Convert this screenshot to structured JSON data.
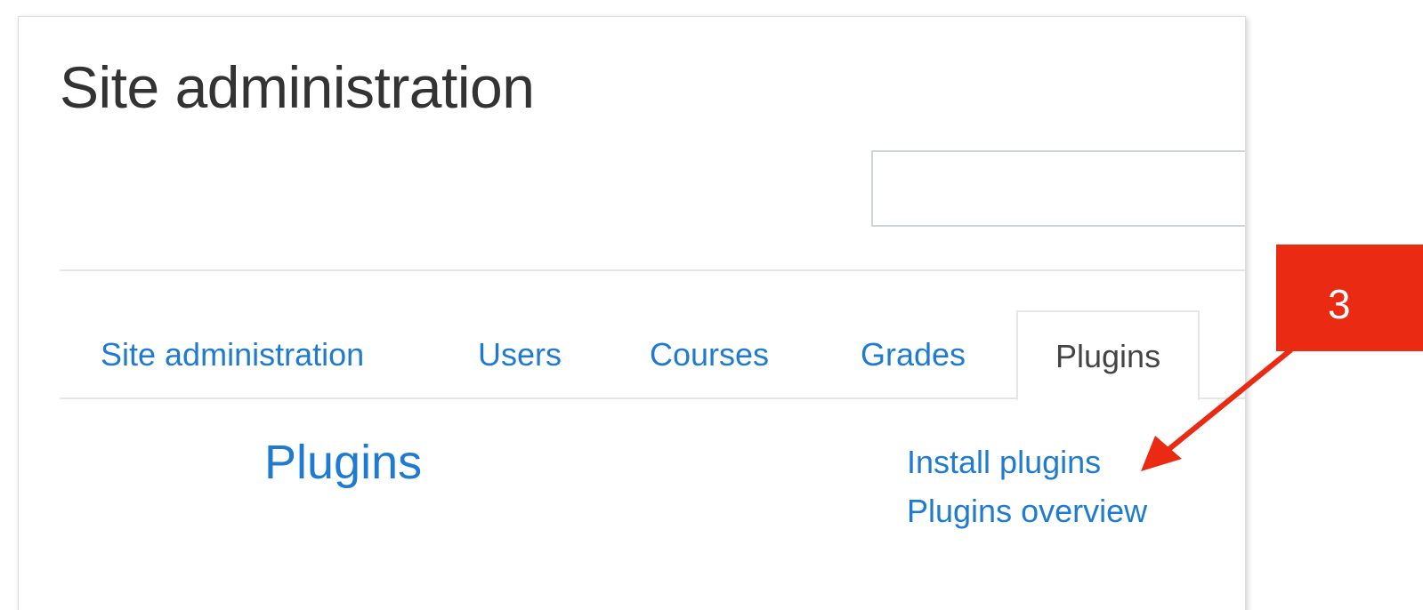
{
  "page": {
    "title": "Site administration"
  },
  "search": {
    "value": "",
    "placeholder": ""
  },
  "tabs": [
    {
      "label": "Site administration",
      "active": false
    },
    {
      "label": "Users",
      "active": false
    },
    {
      "label": "Courses",
      "active": false
    },
    {
      "label": "Grades",
      "active": false
    },
    {
      "label": "Plugins",
      "active": true
    }
  ],
  "section": {
    "title": "Plugins",
    "links": [
      {
        "label": "Install plugins"
      },
      {
        "label": "Plugins overview"
      }
    ]
  },
  "annotation": {
    "label": "3",
    "color": "#ea2a12",
    "icon": "arrow-icon"
  },
  "colors": {
    "link": "#1f7bd1",
    "text": "#333333",
    "border": "#e3e6ea"
  }
}
